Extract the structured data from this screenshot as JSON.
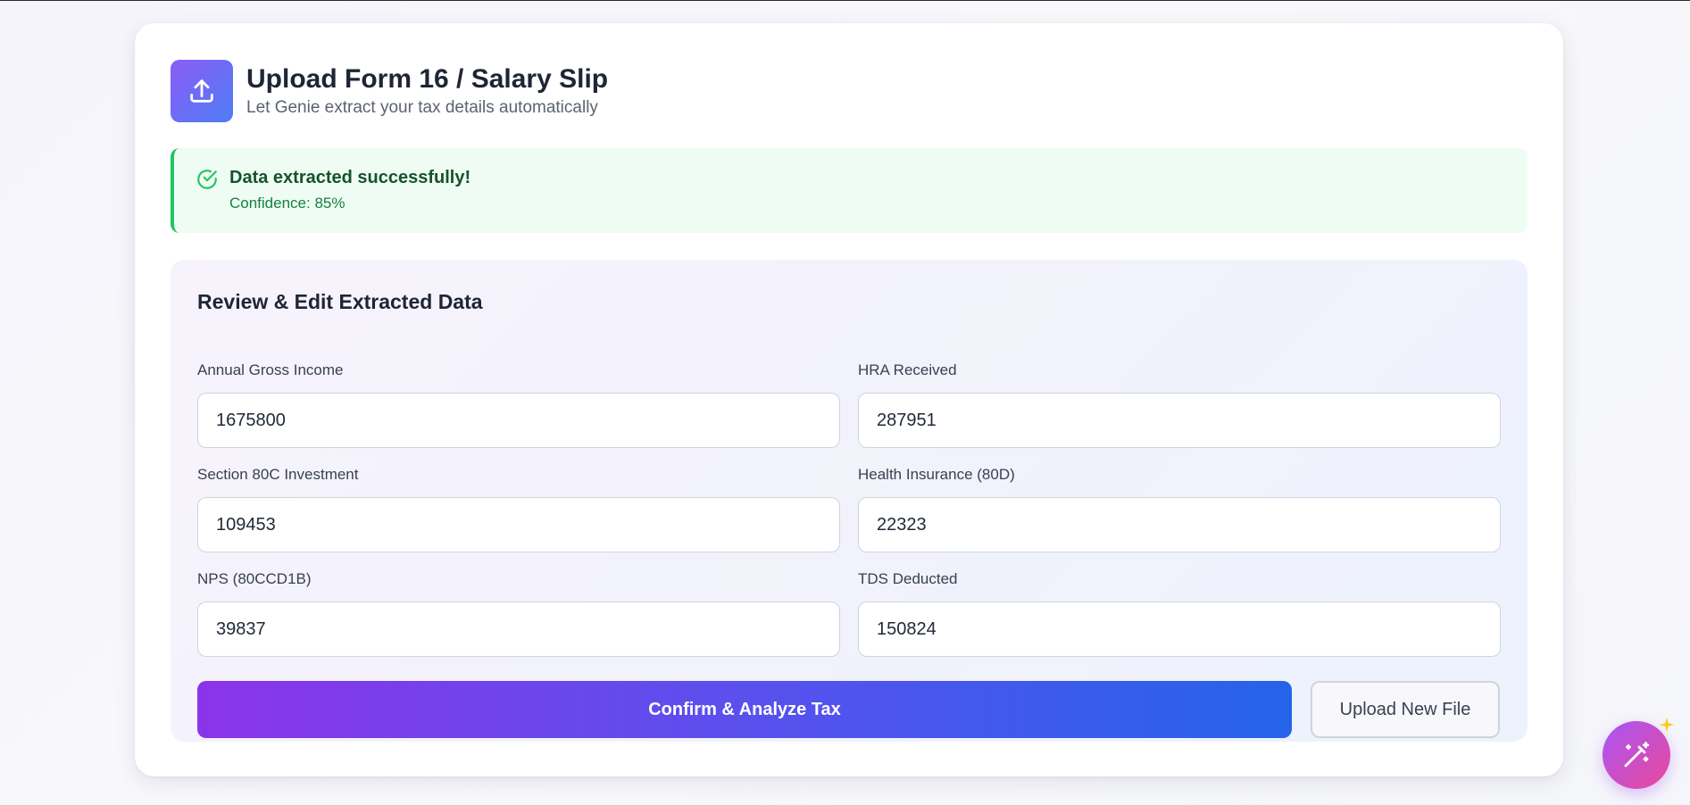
{
  "header": {
    "icon": "upload-icon",
    "title": "Upload Form 16 / Salary Slip",
    "subtitle": "Let Genie extract your tax details automatically"
  },
  "status": {
    "icon": "check-circle-icon",
    "title": "Data extracted successfully!",
    "confidence_text": "Confidence: 85%",
    "color": "#22c55e"
  },
  "review": {
    "title": "Review & Edit Extracted Data",
    "fields": [
      {
        "label": "Annual Gross Income",
        "value": "1675800"
      },
      {
        "label": "HRA Received",
        "value": "287951"
      },
      {
        "label": "Section 80C Investment",
        "value": "109453"
      },
      {
        "label": "Health Insurance (80D)",
        "value": "22323"
      },
      {
        "label": "NPS (80CCD1B)",
        "value": "39837"
      },
      {
        "label": "TDS Deducted",
        "value": "150824"
      }
    ],
    "confirm_label": "Confirm & Analyze Tax",
    "upload_new_label": "Upload New File"
  },
  "fab": {
    "icon": "magic-wand-icon",
    "sparkle_icon": "sparkle-icon"
  },
  "colors": {
    "accent_purple": "#8b34ea",
    "accent_blue": "#2563eb",
    "success_bg": "#effcf3"
  }
}
